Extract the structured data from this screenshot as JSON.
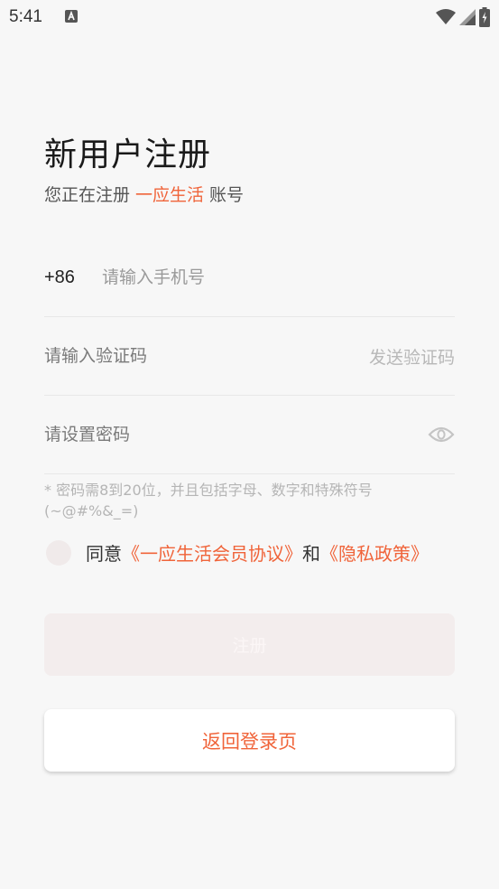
{
  "status_bar": {
    "time": "5:41",
    "icons": [
      "a-notification-icon",
      "wifi-icon",
      "signal-icon",
      "battery-charging-icon"
    ]
  },
  "header": {
    "title": "新用户注册",
    "subtitle_prefix": "您正在注册",
    "brand": "一应生活",
    "subtitle_suffix": "账号"
  },
  "phone_field": {
    "country_code": "+86",
    "value": "",
    "placeholder": "请输入手机号"
  },
  "code_field": {
    "value": "",
    "placeholder": "请输入验证码",
    "send_label": "发送验证码"
  },
  "password_field": {
    "value": "",
    "placeholder": "请设置密码",
    "toggle_icon": "eye-icon"
  },
  "hint": "* 密码需8到20位，并且包括字母、数字和特殊符号(~@#%&_=)",
  "agreement": {
    "prefix": "同意",
    "member_link": "《一应生活会员协议》",
    "joiner": "和",
    "privacy_link": "《隐私政策》"
  },
  "buttons": {
    "register": "注册",
    "back_to_login": "返回登录页"
  },
  "colors": {
    "accent": "#f0643a",
    "background": "#f7f7f7",
    "disabled_button": "#f3eded"
  }
}
